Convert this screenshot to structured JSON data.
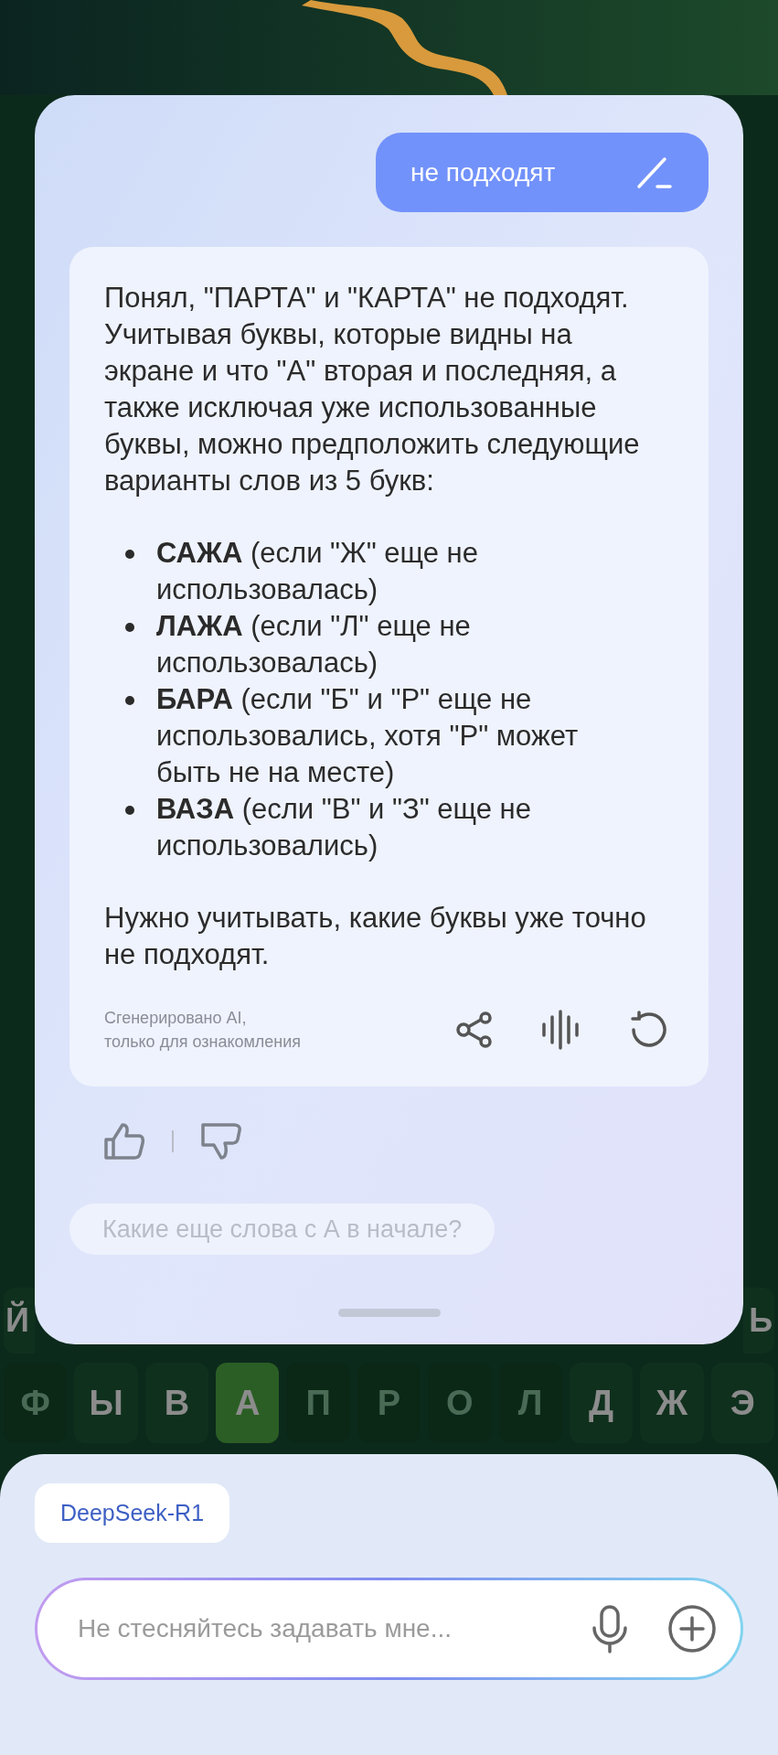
{
  "user_message": {
    "text": "не подходят"
  },
  "answer": {
    "intro": "Понял, \"ПАРТА\" и \"КАРТА\" не подходят. Учитывая буквы, которые видны на экране и что \"А\" вторая и последняя, а также исключая уже использованные буквы, можно предположить следующие варианты слов из 5 букв:",
    "bullets": [
      "**САЖА** (если \"Ж\" еще не использовалась)",
      "**ЛАЖА** (если \"Л\" еще не использовалась)",
      "**БАРА** (если \"Б\" и \"Р\" еще не использовались, хотя \"Р\" может быть не на месте)",
      "**ВАЗА** (если \"В\" и \"З\" еще не использовались)"
    ],
    "outro": "Нужно учитывать, какие буквы уже точно не подходят.",
    "disclaimer": [
      "Сгенерировано AI,",
      "только для ознакомления"
    ]
  },
  "suggestion": "Какие еще слова с А в начале?",
  "keyboard": {
    "row_1": {
      "left_key": "Й",
      "right_key": "Ь"
    },
    "row_2": [
      {
        "letter": "Ф",
        "kind": "absent"
      },
      {
        "letter": "Ы",
        "kind": "unknown"
      },
      {
        "letter": "В",
        "kind": "unknown"
      },
      {
        "letter": "А",
        "kind": "correct"
      },
      {
        "letter": "П",
        "kind": "absent"
      },
      {
        "letter": "Р",
        "kind": "absent"
      },
      {
        "letter": "О",
        "kind": "absent"
      },
      {
        "letter": "Л",
        "kind": "absent"
      },
      {
        "letter": "Д",
        "kind": "unknown"
      },
      {
        "letter": "Ж",
        "kind": "unknown"
      },
      {
        "letter": "Э",
        "kind": "unknown"
      }
    ]
  },
  "model_chip": "DeepSeek-R1",
  "input": {
    "placeholder": "Не стесняйтесь задавать мне..."
  }
}
